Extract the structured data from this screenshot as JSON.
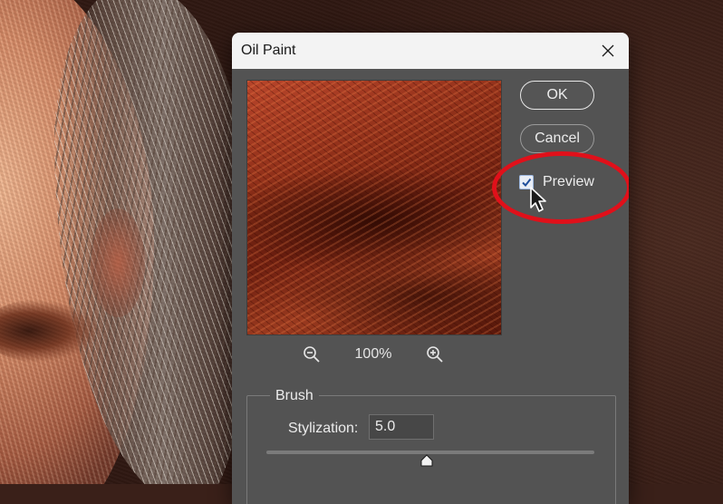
{
  "dialog": {
    "title": "Oil Paint",
    "close_icon": "close-icon",
    "ok_label": "OK",
    "cancel_label": "Cancel",
    "preview_label": "Preview",
    "preview_checked": true
  },
  "zoom": {
    "level": "100%",
    "zoom_out_icon": "zoom-out-icon",
    "zoom_in_icon": "zoom-in-icon"
  },
  "brush": {
    "group_label": "Brush",
    "stylization_label": "Stylization:",
    "stylization_value": "5.0",
    "stylization_slider_fraction": 0.49
  },
  "colors": {
    "highlight": "#e0101a",
    "dialog_bg": "#535353",
    "titlebar_bg": "#f3f3f3"
  }
}
